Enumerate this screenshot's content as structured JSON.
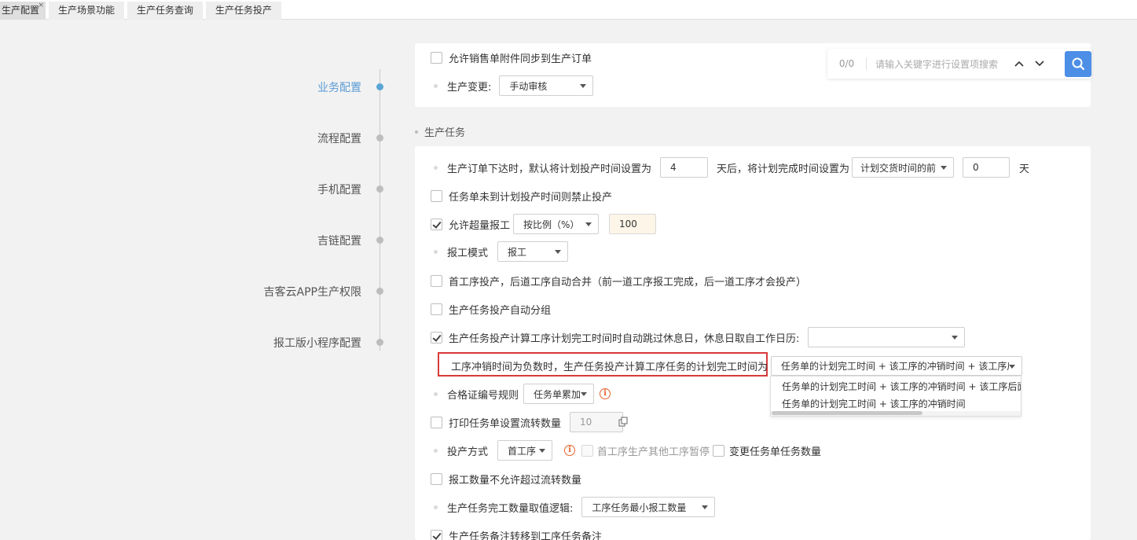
{
  "tabs": [
    {
      "label": "生产配置",
      "close": "×"
    },
    {
      "label": "生产场景功能"
    },
    {
      "label": "生产任务查询"
    },
    {
      "label": "生产任务投产"
    }
  ],
  "nav": {
    "items": [
      "业务配置",
      "流程配置",
      "手机配置",
      "吉链配置",
      "吉客云APP生产权限",
      "报工版小程序配置"
    ]
  },
  "search": {
    "count": "0/0",
    "placeholder": "请输入关键字进行设置项搜索"
  },
  "top_card": {
    "sync_attach_label": "允许销售单附件同步到生产订单",
    "change_label": "生产变更:",
    "change_value": "手动审核"
  },
  "section": {
    "title": "生产任务"
  },
  "rows": {
    "r1_a": "生产订单下达时，默认将计划投产时间设置为",
    "r1_days": "4",
    "r1_b": "天后，将计划完成时间设置为",
    "r1_select": "计划交货时间的前",
    "r1_days2": "0",
    "r1_c": "天",
    "r2": "任务单未到计划投产时间则禁止投产",
    "r3_label": "允许超量报工",
    "r3_select": "按比例（%）",
    "r3_value": "100",
    "r4_label": "报工模式",
    "r4_select": "报工",
    "r5": "首工序投产，后道工序自动合并（前一道工序报工完成，后一道工序才会投产）",
    "r6": "生产任务投产自动分组",
    "r7_label": "生产任务投产计算工序计划完工时间时自动跳过休息日，休息日取自工作日历:",
    "r8_label": "工序冲销时间为负数时，生产任务投产计算工序任务的计划完工时间为",
    "r8_select": "任务单的计划完工时间 + 该工序的冲销时间 + 该工序后",
    "r8_options": [
      "任务单的计划完工时间 + 该工序的冲销时间 + 该工序后面",
      "任务单的计划完工时间 + 该工序的冲销时间"
    ],
    "r9_label": "合格证编号规则",
    "r9_select": "任务单累加",
    "r10_label": "打印任务单设置流转数量",
    "r10_value": "10",
    "r11_label": "投产方式",
    "r11_select": "首工序",
    "r11_opt1": "首工序生产其他工序暂停",
    "r11_opt2": "变更任务单任务数量",
    "r12": "报工数量不允许超过流转数量",
    "r13_label": "生产任务完工数量取值逻辑:",
    "r13_select": "工序任务最小报工数量",
    "r14": "生产任务备注转移到工序任务备注"
  }
}
